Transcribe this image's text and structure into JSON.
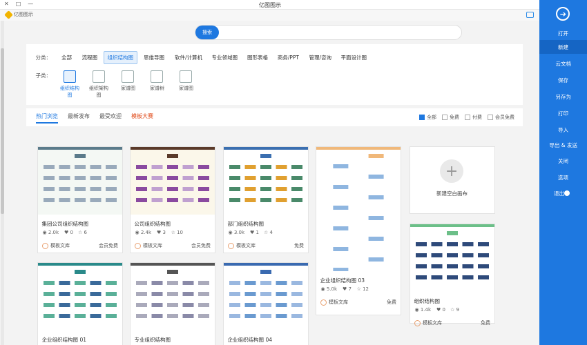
{
  "window": {
    "title": "亿图图示",
    "controls": [
      "—",
      "□",
      "✕"
    ]
  },
  "account": {
    "name": "亿图图示"
  },
  "sidebar": {
    "items": [
      {
        "label": "打开"
      },
      {
        "label": "新建",
        "active": true
      },
      {
        "label": "云文档"
      },
      {
        "label": "保存"
      },
      {
        "label": "另存为"
      },
      {
        "label": "打印"
      },
      {
        "label": "导入"
      },
      {
        "label": "导出 & 发送"
      },
      {
        "label": "关闭"
      },
      {
        "label": "选项"
      },
      {
        "label": "退出"
      }
    ]
  },
  "search": {
    "button": "搜索",
    "placeholder": ""
  },
  "categories": {
    "label": "分类：",
    "items": [
      "全部",
      "流程图",
      "组织结构图",
      "思维导图",
      "软件/计算机",
      "专业领域图",
      "图形表格",
      "商务/PPT",
      "管理/咨询",
      "平面设计图"
    ],
    "active": 2
  },
  "subtypes": {
    "label": "子类：",
    "items": [
      "组织结构图",
      "组织架构图",
      "家谱图",
      "家谱树",
      "家谱图"
    ],
    "active": 0
  },
  "tabs": {
    "items": [
      "热门浏览",
      "最新发布",
      "最受欢迎",
      "模板大赛"
    ],
    "active": 0,
    "hot_index": 3
  },
  "filters": [
    {
      "label": "全部",
      "checked": true
    },
    {
      "label": "免费",
      "checked": false
    },
    {
      "label": "付费",
      "checked": false
    },
    {
      "label": "会员免费",
      "checked": false
    }
  ],
  "new_card": {
    "label": "新建空白画布"
  },
  "cards": [
    {
      "name": "组织结构图",
      "views": "1.4k",
      "likes": "0",
      "favs": "9",
      "author": "模板文库",
      "tag": "免费"
    },
    {
      "name": "企业组织结构图 03",
      "views": "5.0k",
      "likes": "7",
      "favs": "12",
      "author": "模板文库",
      "tag": "免费"
    },
    {
      "name": "部门组织结构图",
      "views": "3.0k",
      "likes": "1",
      "favs": "4",
      "author": "模板文库",
      "tag": "免费"
    },
    {
      "name": "公司组织结构图",
      "views": "2.4k",
      "likes": "3",
      "favs": "10",
      "author": "模板文库",
      "tag": "会员免费"
    },
    {
      "name": "集团公司组织结构图",
      "views": "2.0k",
      "likes": "0",
      "favs": "6",
      "author": "模板文库",
      "tag": "会员免费"
    },
    {
      "name": "企业组织结构图 04",
      "views": "",
      "likes": "",
      "favs": "",
      "author": "",
      "tag": ""
    },
    {
      "name": "专业组织结构图",
      "views": "",
      "likes": "",
      "favs": "",
      "author": "",
      "tag": ""
    },
    {
      "name": "企业组织结构图 01",
      "views": "",
      "likes": "",
      "favs": "",
      "author": "",
      "tag": ""
    }
  ]
}
